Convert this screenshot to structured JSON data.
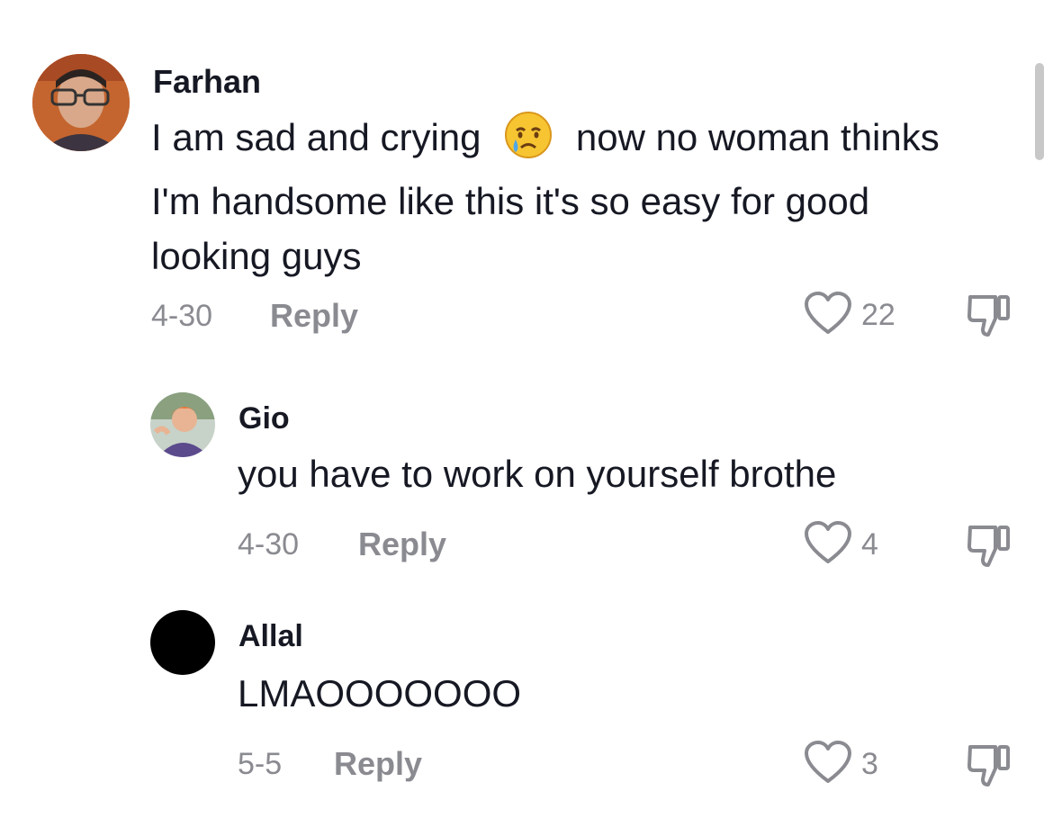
{
  "comments": [
    {
      "username": "Farhan",
      "text_part1": "I am sad and crying",
      "emoji": "crying-face-emoji",
      "text_part2": "now no woman thinks",
      "text_line2": "I'm handsome like this it's so easy for good",
      "text_line3": "looking guys",
      "date": "4-30",
      "reply_label": "Reply",
      "likes": "22"
    },
    {
      "username": "Gio",
      "text": "you have to work on yourself brothe",
      "date": "4-30",
      "reply_label": "Reply",
      "likes": "4"
    },
    {
      "username": "Allal",
      "text": "LMAOOOOOOO",
      "date": "5-5",
      "reply_label": "Reply",
      "likes": "3"
    }
  ],
  "icons": {
    "like": "heart-outline-icon",
    "dislike": "thumbs-down-icon"
  },
  "colors": {
    "text": "#161823",
    "muted": "#8a8b91",
    "background": "#ffffff"
  }
}
